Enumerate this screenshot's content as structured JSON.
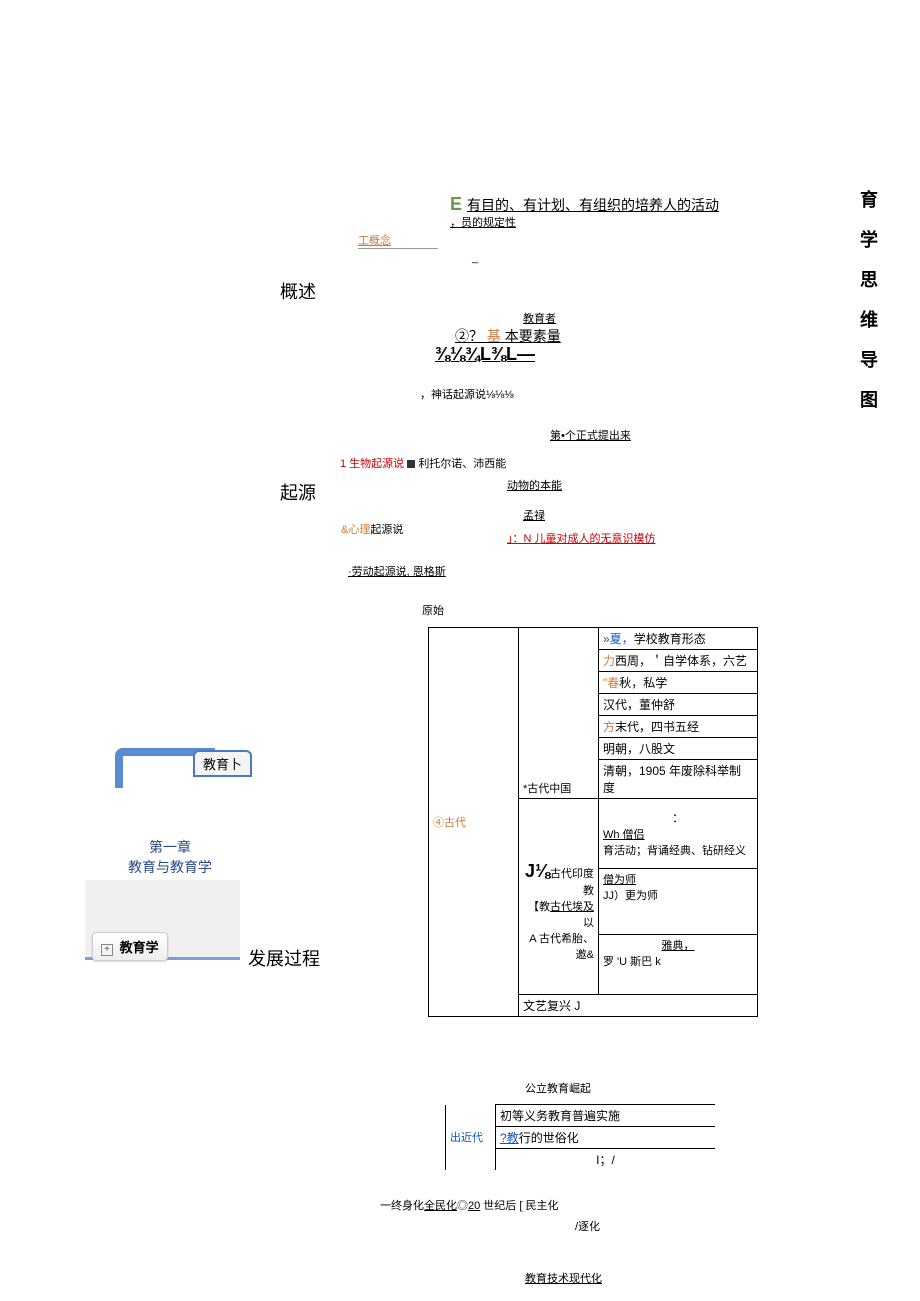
{
  "vertical_title": [
    "育",
    "学",
    "思",
    "维",
    "导",
    "图"
  ],
  "overview": {
    "E_line": "有目的、有计划、有组织的培养人的活动",
    "sub1": "，员的规定性",
    "concept_label": "工概念",
    "section_label": "概述",
    "educator": "教育者",
    "basic_elements": "②？基本要素量",
    "fraction_line": "⅜⅛¾L⅜L—",
    "myth": "，神话起源说⅛⅛⅛"
  },
  "origin": {
    "first_formal": "第•个正式提出来",
    "bio_line": "1 生物起源说",
    "bio_people": "利托尔诺、沛西能",
    "animal": "动物的本能",
    "section_label": "起源",
    "psych_label": "&心理起源说",
    "menglu": "孟禄",
    "child_imitate": "」：N 儿童对成人的无意识模仿",
    "labor": "·劳动起源说, 恩格斯"
  },
  "development": {
    "section_label": "发展过程",
    "primitive": "原始",
    "ancient_label": "④古代",
    "china_label": "*古代中国",
    "china_rows": {
      "r1": "»夏，学校教育形态",
      "r2": "力西周，＇自学体系，六艺",
      "r3": "\"春秋，私学",
      "r4": "汉代，董仲舒",
      "r5": "方末代，四书五经",
      "r6": "明朝，八股文",
      "r7": "清朝，1905 年废除科举制度"
    },
    "india_frac": "J⅛古代印度教",
    "wh": "Wh 僧侣",
    "activity": "育活动；背诵经典、钻研经义",
    "monk": "僧为师",
    "egypt": "【教古代埃及以",
    "jj": "JJ）更为师",
    "greece_rome": "A 古代希胎、邀&",
    "athens": "雅典，",
    "rome_sparta": "罗 'U 斯巴 k",
    "renaissance": "文艺复兴 J",
    "public_edu": "公立教育崛起",
    "modern_label": "出近代",
    "modern_r1": "初等义务教育普遍实施",
    "modern_r2": "?教行的世俗化",
    "modern_r3": "I；/",
    "lifelong": "一终身化全民化◎20 世纪后 [ 民主化",
    "gradual": "/逐化",
    "tech_modern": "教育技术现代化"
  },
  "nav": {
    "edu_tab": "教育卜",
    "chapter_title": "第一章",
    "chapter_sub": "教育与教育学",
    "pedagogy": "教育学"
  }
}
